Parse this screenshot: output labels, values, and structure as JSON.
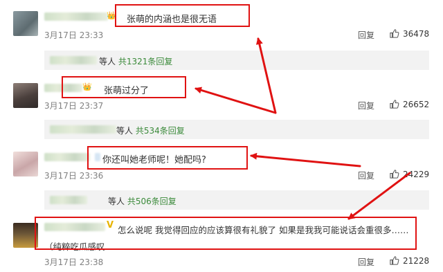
{
  "comments": [
    {
      "text": "张萌的内涵也是很无语",
      "time": "3月17日 23:33",
      "reply": "回复",
      "likes": "36478"
    },
    {
      "text": "张萌过分了",
      "time": "3月17日 23:37",
      "reply": "回复",
      "likes": "26652"
    },
    {
      "text": "你还叫她老师呢！她配吗?",
      "time": "3月17日 23:36",
      "reply": "回复",
      "likes": "24229"
    },
    {
      "text": "怎么说呢 我觉得回应的应该算很有礼貌了 如果是我我可能说话会重很多……",
      "text2": "（纯粹吃瓜感叹",
      "time": "3月17日 23:38",
      "reply": "回复",
      "likes": "21228"
    }
  ],
  "subreplies": [
    {
      "prefix": "等人",
      "count": "共1321条回复"
    },
    {
      "prefix": "等人",
      "count": "共534条回复"
    },
    {
      "prefix": "等人",
      "count": "共506条回复"
    }
  ],
  "colors": {
    "annotation_red": "#e01212",
    "link_green": "#3b8a3a",
    "subbar_bg": "#f2f2f2"
  }
}
